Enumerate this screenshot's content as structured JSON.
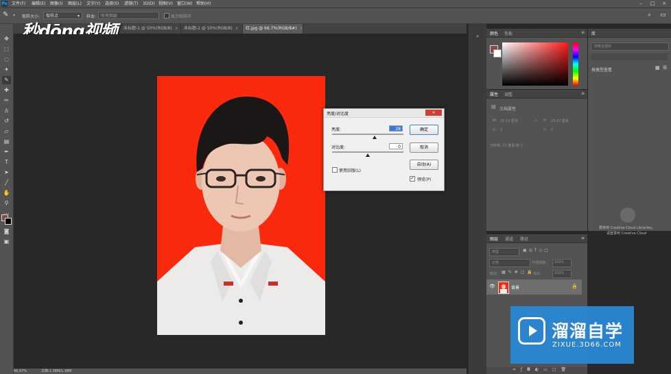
{
  "menubar": {
    "app_icon": "Ps",
    "items": [
      "文件(F)",
      "编辑(E)",
      "图像(I)",
      "图层(L)",
      "文字(Y)",
      "选择(S)",
      "滤镜(T)",
      "3D(D)",
      "视图(V)",
      "窗口(W)",
      "帮助(H)"
    ]
  },
  "options": {
    "sample_size_label": "取样大小:",
    "sample_size_value": "取样点",
    "sample_label": "样本:",
    "sample_value": "所有图层",
    "show_ring_label": "显示取样环"
  },
  "watermark_top": "秒dōng视频",
  "tabs": [
    {
      "label": "未标题-1 @ 50%(RGB/8)",
      "close": "×"
    },
    {
      "label": "未标题-2 @ 50%(RGB/8)",
      "close": "×"
    },
    {
      "label": "红.jpg @ 66.7%(RGB/8#)",
      "close": "×"
    }
  ],
  "status": {
    "zoom": "66.67%",
    "doc": "文档:1.38M/1.38M"
  },
  "dialog": {
    "title": "亮度/对比度",
    "close": "×",
    "brightness_label": "亮度:",
    "brightness_value": "28",
    "contrast_label": "对比度:",
    "contrast_value": "0",
    "legacy_label": "使用旧版(L)",
    "ok": "确定",
    "cancel": "取消",
    "auto": "自动(A)",
    "preview_label": "预览(P)",
    "preview_checked": true,
    "brightness_fraction": 0.6,
    "contrast_fraction": 0.5
  },
  "color_panel": {
    "tabs": [
      "颜色",
      "色板"
    ],
    "fg_color": "#8a4a3e",
    "bg_color": "#ffffff"
  },
  "properties_panel": {
    "tabs": [
      "属性",
      "调整"
    ],
    "doc_title": "文档属性",
    "w_label": "W:",
    "w_value": "25.15 厘米",
    "h_label": "H:",
    "h_value": "33.87 厘米",
    "x_label": "X:",
    "x_value": "0",
    "y_label": "Y:",
    "y_value": "0",
    "resolution": "分辨率: 72 像素/英寸"
  },
  "libraries_panel": {
    "tab": "库",
    "search_placeholder": "搜索全部库",
    "filter": "按类型查看",
    "cloud_text_1": "要使用 Creative Cloud Libraries，",
    "cloud_text_2": "请登录到 Creative Cloud"
  },
  "layers_panel": {
    "tabs": [
      "图层",
      "通道",
      "路径"
    ],
    "kind_placeholder": "类型",
    "blend_mode": "正常",
    "opacity_label": "不透明度:",
    "opacity_value": "100%",
    "lock_label": "锁定:",
    "fill_label": "填充:",
    "fill_value": "100%",
    "layer_name": "背景",
    "bottom_icons": [
      "link",
      "fx",
      "mask",
      "adjustment",
      "group",
      "new",
      "trash"
    ]
  },
  "watermark_bottom": {
    "big": "溜溜自学",
    "small": "ZIXUE.3D66.COM"
  }
}
